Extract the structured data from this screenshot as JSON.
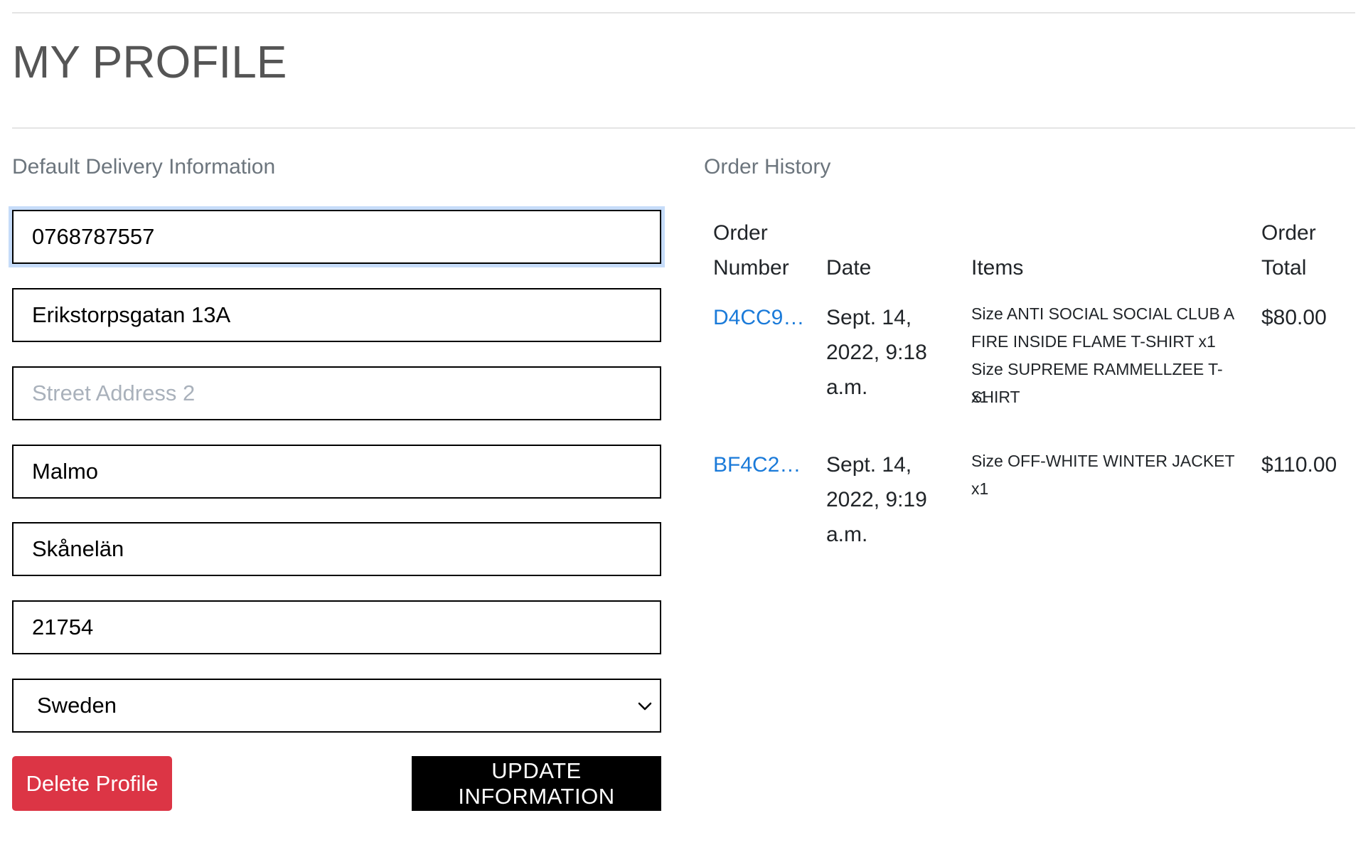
{
  "page": {
    "title": "MY PROFILE"
  },
  "delivery": {
    "heading": "Default Delivery Information",
    "phone": "0768787557",
    "street1": "Erikstorpsgatan 13A",
    "street2_placeholder": "Street Address 2",
    "city": "Malmo",
    "county": "Skånelän",
    "postcode": "21754",
    "country": "Sweden",
    "delete_label": "Delete Profile",
    "update_label": "UPDATE INFORMATION"
  },
  "orders": {
    "heading": "Order History",
    "columns": {
      "number_line1": "Order",
      "number_line2": "Number",
      "date": "Date",
      "items": "Items",
      "total_line1": "Order",
      "total_line2": "Total"
    },
    "rows": [
      {
        "number": "D4CC9…",
        "date_line1": "Sept. 14,",
        "date_line2": "2022, 9:18",
        "date_line3": "a.m.",
        "item1_line1": "Size ANTI SOCIAL SOCIAL CLUB A",
        "item1_line2": "FIRE INSIDE FLAME T-SHIRT x1",
        "item2_line1": "Size SUPREME RAMMELLZEE T-SHIRT",
        "item2_line2": "x1",
        "total": "$80.00"
      },
      {
        "number": "BF4C2…",
        "date_line1": "Sept. 14,",
        "date_line2": "2022, 9:19",
        "date_line3": "a.m.",
        "item1_line1": "Size OFF-WHITE WINTER JACKET x1",
        "total": "$110.00"
      }
    ]
  },
  "icons": {
    "select_arrow": "chevron-down-icon"
  }
}
